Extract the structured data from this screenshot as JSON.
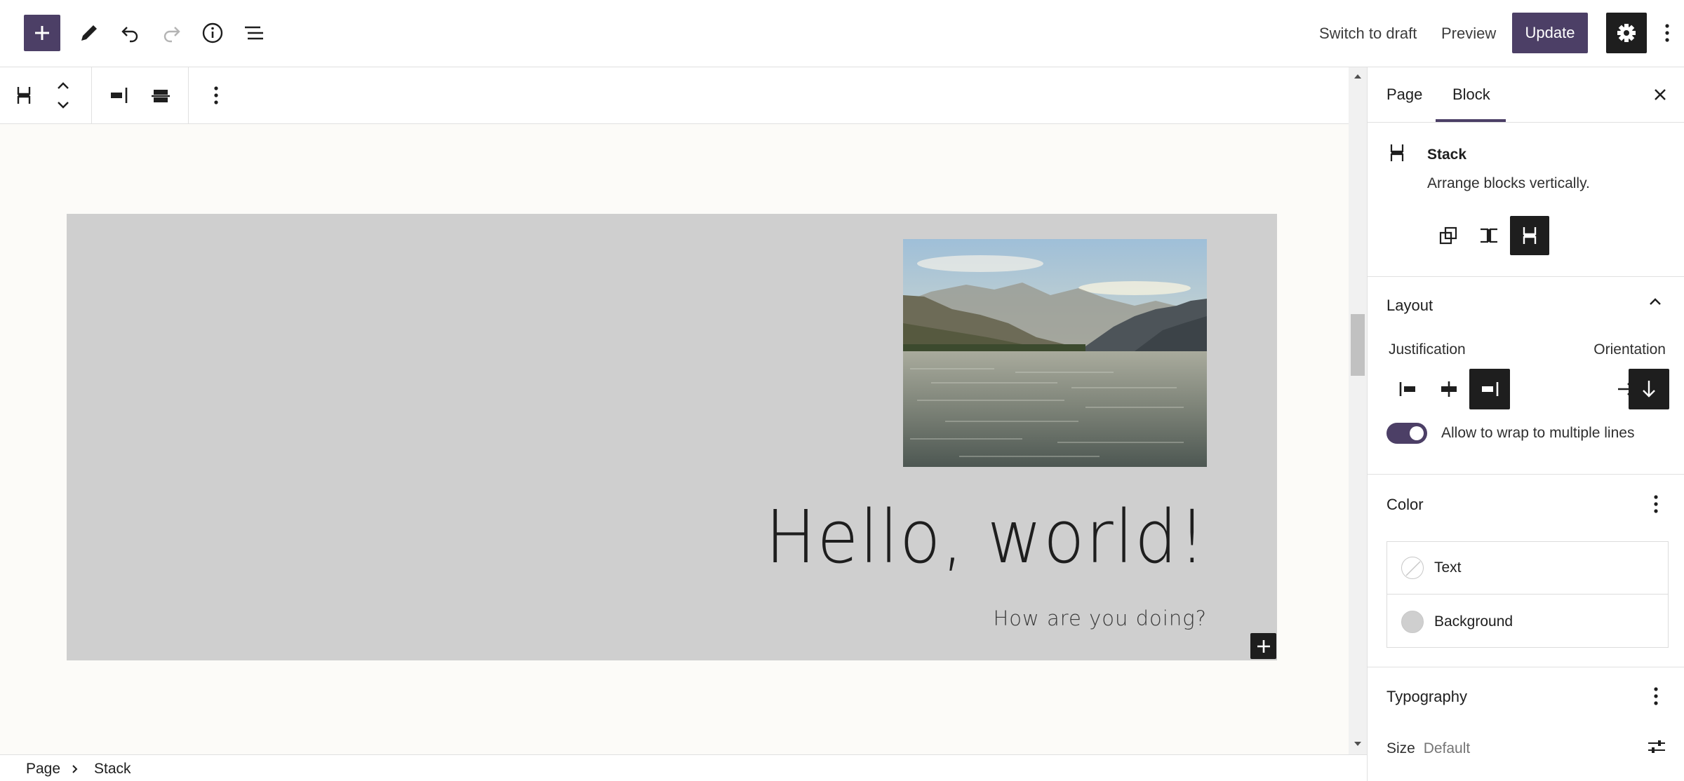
{
  "topbar": {
    "switch_to_draft": "Switch to draft",
    "preview": "Preview",
    "update": "Update"
  },
  "canvas": {
    "heading": "Hello, world!",
    "subheading": "How are you doing?"
  },
  "breadcrumb": {
    "items": [
      "Page",
      "Stack"
    ]
  },
  "sidebar": {
    "tabs": [
      "Page",
      "Block"
    ],
    "active_tab": "Block",
    "block": {
      "name": "Stack",
      "description": "Arrange blocks vertically."
    },
    "layout": {
      "title": "Layout",
      "justification_label": "Justification",
      "orientation_label": "Orientation",
      "wrap_label": "Allow to wrap to multiple lines",
      "wrap_enabled": true
    },
    "color": {
      "title": "Color",
      "items": [
        {
          "label": "Text"
        },
        {
          "label": "Background",
          "swatch": "#cfcfcf"
        }
      ]
    },
    "typography": {
      "title": "Typography",
      "size_label": "Size",
      "size_value": "Default"
    }
  },
  "colors": {
    "accent": "#4c3f66",
    "dark": "#1e1e1e",
    "canvas_bg": "#fcfbf8",
    "block_bg": "#cfcfcf"
  }
}
